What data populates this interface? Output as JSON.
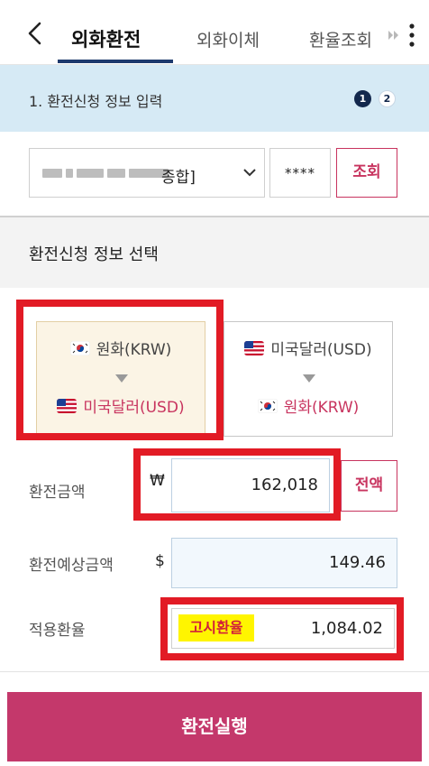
{
  "nav": {
    "tabs": [
      {
        "label": "외화환전",
        "active": true
      },
      {
        "label": "외화이체",
        "active": false
      },
      {
        "label": "환율조회",
        "active": false
      }
    ]
  },
  "step": {
    "title": "1. 환전신청 정보 입력",
    "current": "1",
    "total_label": "2"
  },
  "account": {
    "suffix_visible": "종합]",
    "password_mask": "****",
    "inquiry_label": "조회"
  },
  "section": {
    "title": "환전신청 정보 선택"
  },
  "exchange_options": [
    {
      "from": "원화(KRW)",
      "to": "미국달러(USD)",
      "selected": true
    },
    {
      "from": "미국달러(USD)",
      "to": "원화(KRW)",
      "selected": false
    }
  ],
  "form": {
    "amount_label": "환전금액",
    "amount_currency": "₩",
    "amount_value": "162,018",
    "all_button": "전액",
    "expected_label": "환전예상금액",
    "expected_currency": "$",
    "expected_value": "149.46",
    "rate_label": "적용환율",
    "rate_type": "고시환율",
    "rate_value": "1,084.02"
  },
  "actions": {
    "execute_label": "환전실행"
  },
  "colors": {
    "accent": "#c4386b",
    "nav_dark": "#1e3a6d",
    "step_bg": "#d6eaf5",
    "highlight": "#e21b25",
    "badge_bg": "#fff500"
  }
}
